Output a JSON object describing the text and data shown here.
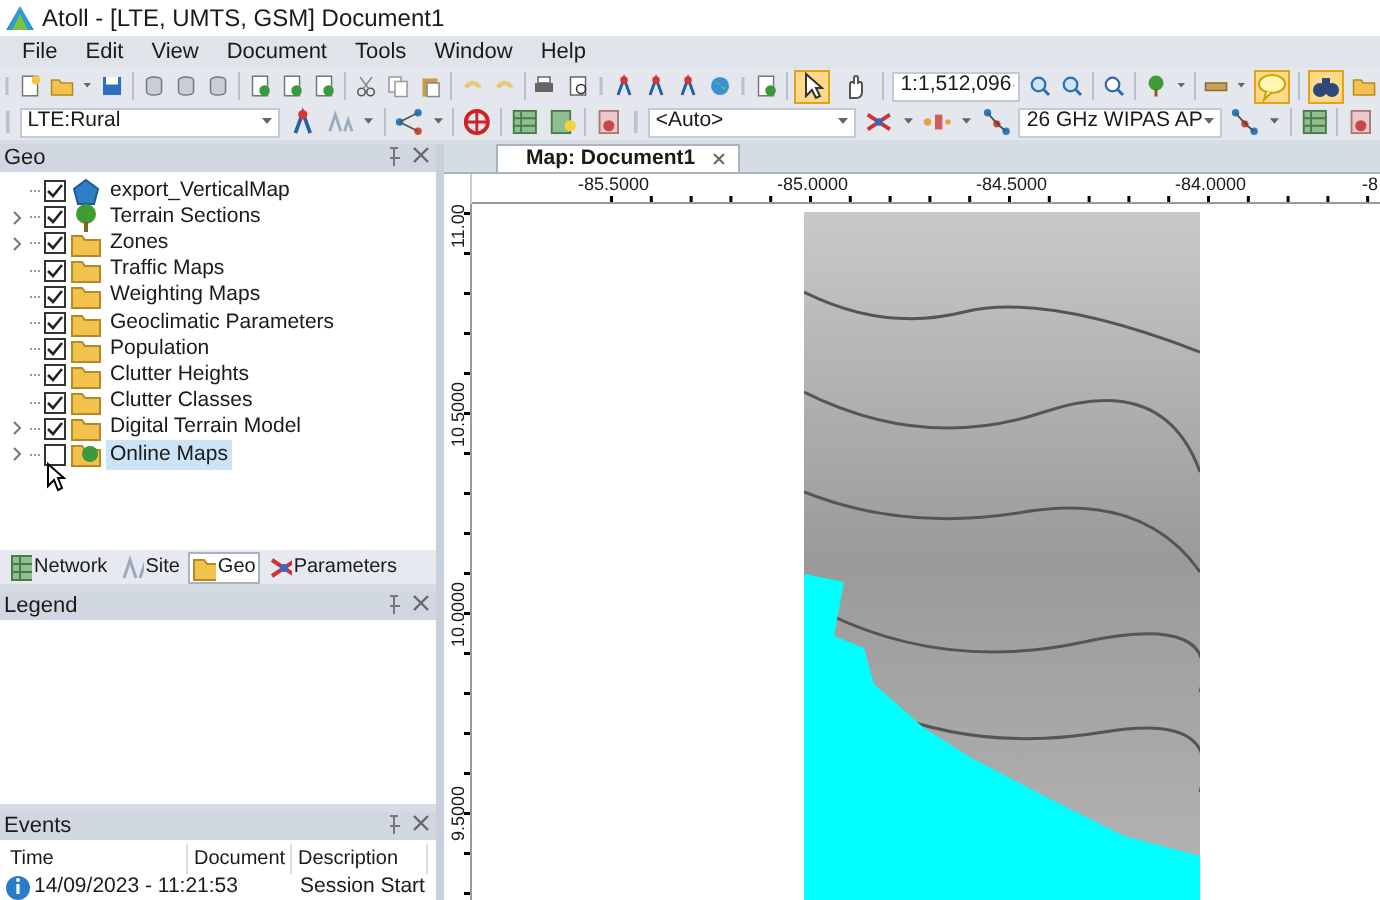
{
  "window": {
    "title": "Atoll - [LTE, UMTS, GSM] Document1"
  },
  "menu": [
    "File",
    "Edit",
    "View",
    "Document",
    "Tools",
    "Window",
    "Help"
  ],
  "toolbar": {
    "scale": "1:1,512,096",
    "toggles": [
      {
        "kind": "pointer",
        "pressed": true
      },
      {
        "kind": "hand",
        "pressed": false
      },
      {
        "kind": "tooltip",
        "pressed": true
      },
      {
        "kind": "binoculars",
        "pressed": true
      }
    ]
  },
  "toolbar2": {
    "technology": "LTE:Rural",
    "station_filter": "<Auto>",
    "station_template": "26 GHz WIPAS AP"
  },
  "geo_panel": {
    "title": "Geo",
    "items": [
      {
        "label": "export_VerticalMap",
        "kind": "vector",
        "checked": true,
        "expandable": false,
        "selected": false
      },
      {
        "label": "Terrain Sections",
        "kind": "tree",
        "checked": true,
        "expandable": true,
        "selected": false
      },
      {
        "label": "Zones",
        "kind": "folder",
        "checked": true,
        "expandable": true,
        "selected": false
      },
      {
        "label": "Traffic Maps",
        "kind": "folder",
        "checked": true,
        "expandable": false,
        "selected": false
      },
      {
        "label": "Weighting Maps",
        "kind": "folder",
        "checked": true,
        "expandable": false,
        "selected": false
      },
      {
        "label": "Geoclimatic Parameters",
        "kind": "folder",
        "checked": true,
        "expandable": false,
        "selected": false
      },
      {
        "label": "Population",
        "kind": "folder",
        "checked": true,
        "expandable": false,
        "selected": false
      },
      {
        "label": "Clutter Heights",
        "kind": "folder",
        "checked": true,
        "expandable": false,
        "selected": false
      },
      {
        "label": "Clutter Classes",
        "kind": "folder",
        "checked": true,
        "expandable": false,
        "selected": false
      },
      {
        "label": "Digital Terrain Model",
        "kind": "folder",
        "checked": true,
        "expandable": true,
        "selected": false
      },
      {
        "label": "Online Maps",
        "kind": "globe",
        "checked": false,
        "expandable": true,
        "selected": true
      }
    ],
    "tabs": [
      {
        "label": "Network",
        "selected": false
      },
      {
        "label": "Site",
        "selected": false
      },
      {
        "label": "Geo",
        "selected": true
      },
      {
        "label": "Parameters",
        "selected": false
      }
    ]
  },
  "legend_panel": {
    "title": "Legend"
  },
  "events_panel": {
    "title": "Events",
    "columns": [
      "Time",
      "Document",
      "Description"
    ],
    "rows": [
      {
        "time": "14/09/2023 - 11:21:53",
        "description": "Session Start"
      }
    ]
  },
  "map": {
    "tab_label": "Map: Document1",
    "x_labels": [
      "-85.5000",
      "-85.0000",
      "-84.5000",
      "-84.0000",
      "-8"
    ],
    "y_labels": [
      "11.00",
      "10.5000",
      "10.0000",
      "9.5000"
    ]
  }
}
